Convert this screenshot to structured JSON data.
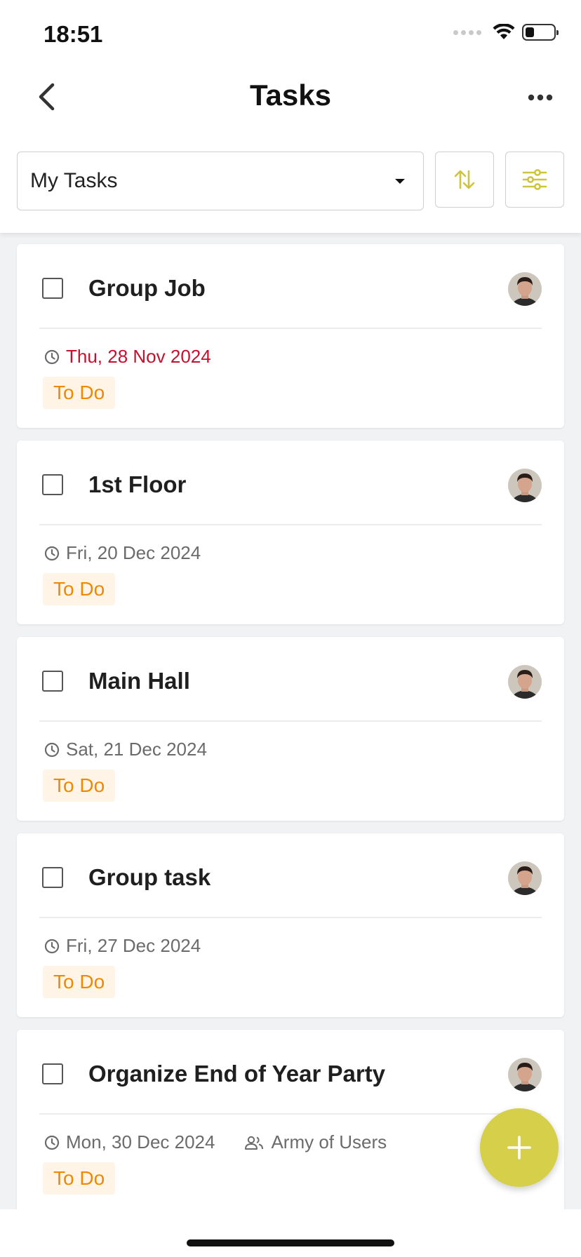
{
  "status_bar": {
    "time": "18:51"
  },
  "header": {
    "title": "Tasks"
  },
  "filter": {
    "selected": "My Tasks"
  },
  "colors": {
    "accent": "#d6cf4a",
    "overdue": "#c8102e",
    "status_text": "#ef8a00",
    "status_bg": "#fff4e5"
  },
  "tasks": [
    {
      "title": "Group Job",
      "date": "Thu, 28 Nov 2024",
      "overdue": true,
      "status": "To Do"
    },
    {
      "title": "1st Floor",
      "date": "Fri, 20 Dec 2024",
      "overdue": false,
      "status": "To Do"
    },
    {
      "title": "Main Hall",
      "date": "Sat, 21 Dec 2024",
      "overdue": false,
      "status": "To Do"
    },
    {
      "title": "Group task",
      "date": "Fri, 27 Dec 2024",
      "overdue": false,
      "status": "To Do"
    },
    {
      "title": "Organize End of Year Party",
      "date": "Mon, 30 Dec 2024",
      "overdue": false,
      "group": "Army of Users",
      "status": "To Do"
    }
  ]
}
